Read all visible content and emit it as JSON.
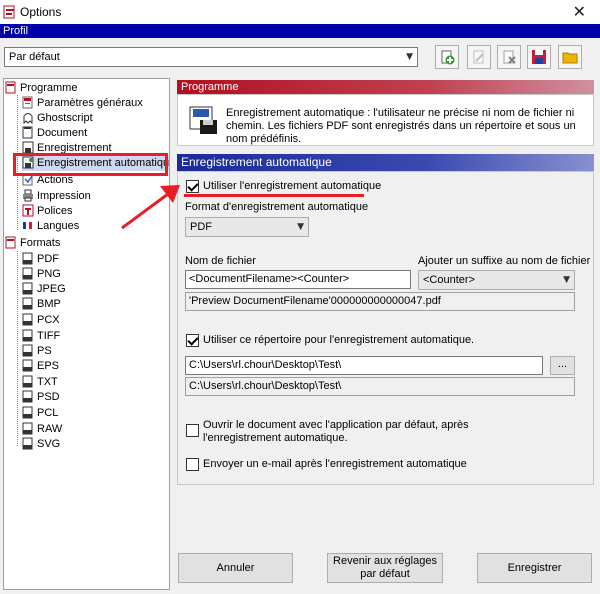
{
  "window": {
    "title": "Options",
    "close_glyph": "✕"
  },
  "profile": {
    "section_label": "Profil",
    "selected": "Par défaut"
  },
  "toolbar": {
    "icons": [
      "add-profile-icon",
      "rename-profile-icon",
      "delete-profile-icon",
      "save-icon",
      "open-folder-icon"
    ]
  },
  "tree": {
    "programme": {
      "label": "Programme",
      "items": [
        {
          "label": "Paramètres généraux",
          "icon": "settings-icon"
        },
        {
          "label": "Ghostscript",
          "icon": "ghostscript-icon"
        },
        {
          "label": "Document",
          "icon": "document-icon"
        },
        {
          "label": "Enregistrement",
          "icon": "save-icon"
        },
        {
          "label": "Enregistrement automatique",
          "icon": "autosave-icon"
        },
        {
          "label": "Actions",
          "icon": "actions-icon"
        },
        {
          "label": "Impression",
          "icon": "printer-icon"
        },
        {
          "label": "Polices",
          "icon": "fonts-icon"
        },
        {
          "label": "Langues",
          "icon": "language-flag-icon"
        }
      ]
    },
    "formats": {
      "label": "Formats",
      "items": [
        {
          "label": "PDF"
        },
        {
          "label": "PNG"
        },
        {
          "label": "JPEG"
        },
        {
          "label": "BMP"
        },
        {
          "label": "PCX"
        },
        {
          "label": "TIFF"
        },
        {
          "label": "PS"
        },
        {
          "label": "EPS"
        },
        {
          "label": "TXT"
        },
        {
          "label": "PSD"
        },
        {
          "label": "PCL"
        },
        {
          "label": "RAW"
        },
        {
          "label": "SVG"
        }
      ]
    }
  },
  "header": {
    "band_title": "Programme",
    "description": "Enregistrement automatique : l'utilisateur ne précise ni nom de fichier ni chemin. Les fichiers PDF sont enregistrés dans un répertoire et sous un nom prédéfinis."
  },
  "autosave": {
    "band_title": "Enregistrement automatique",
    "use_autosave": {
      "label": "Utiliser l'enregistrement automatique",
      "checked": true
    },
    "format": {
      "label": "Format d'enregistrement automatique",
      "value": "PDF"
    },
    "filename": {
      "label": "Nom de fichier",
      "value": "<DocumentFilename><Counter>",
      "preview": "'Preview DocumentFilename'000000000000047.pdf"
    },
    "suffix": {
      "label": "Ajouter un suffixe au nom de fichier",
      "value": "<Counter>"
    },
    "use_dir": {
      "label": "Utiliser ce répertoire pour l'enregistrement automatique.",
      "checked": true
    },
    "directory": {
      "value": "C:\\Users\\rl.chour\\Desktop\\Test\\",
      "resolved": "C:\\Users\\rl.chour\\Desktop\\Test\\",
      "browse_label": "..."
    },
    "open_after": {
      "label": "Ouvrir le document avec l'application par défaut, après l'enregistrement automatique.",
      "checked": false
    },
    "email_after": {
      "label": "Envoyer un e-mail après l'enregistrement automatique",
      "checked": false
    }
  },
  "buttons": {
    "cancel": "Annuler",
    "reset": "Revenir aux réglages par défaut",
    "save": "Enregistrer"
  },
  "colors": {
    "profile_band": "#0000a8",
    "programme_band": "#b01020",
    "section_band": "#1a2a9a",
    "annotation": "#e81d25"
  }
}
